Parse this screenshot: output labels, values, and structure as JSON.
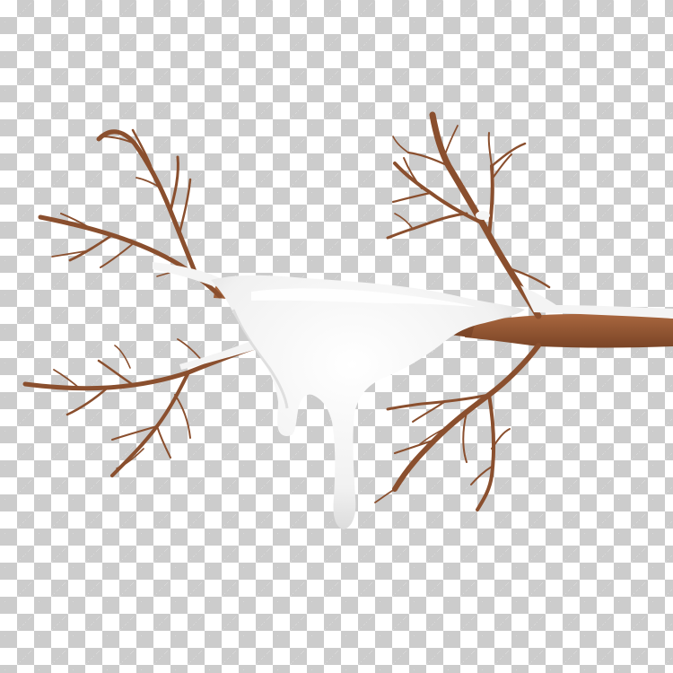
{
  "image": {
    "subject": "snow-icon",
    "background": "transparency-checkerboard",
    "colors": {
      "branch": "#8a4f2e",
      "branch_highlight": "#a9673f",
      "snow": "#f4f4f4",
      "snow_shadow": "#d9d9d9",
      "checker_light": "#ffffff",
      "checker_dark": "#cccccc"
    }
  }
}
